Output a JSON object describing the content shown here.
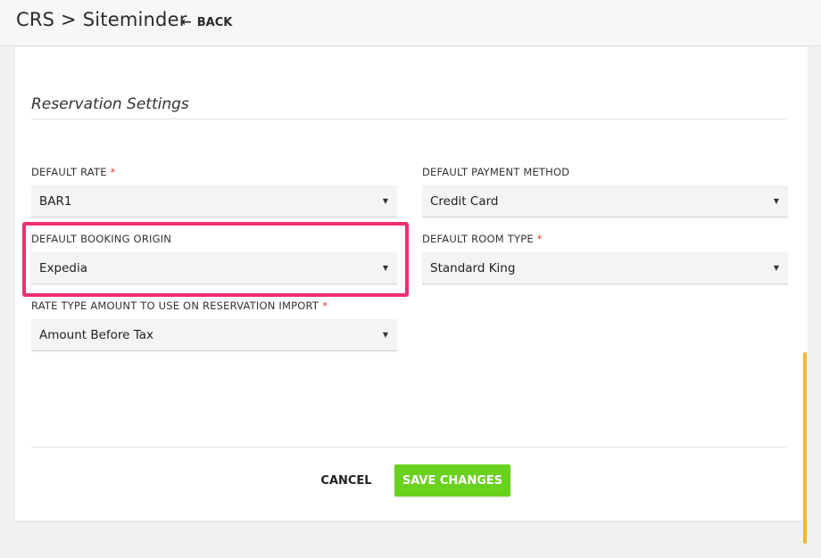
{
  "header": {
    "breadcrumb": "CRS > Siteminder",
    "back_label": "BACK",
    "back_icon": "arrow-left-icon"
  },
  "section": {
    "title": "Reservation Settings"
  },
  "fields": {
    "default_rate": {
      "label": "DEFAULT RATE",
      "required": "*",
      "value": "BAR1"
    },
    "default_payment_method": {
      "label": "DEFAULT PAYMENT METHOD",
      "value": "Credit Card"
    },
    "default_booking_origin": {
      "label": "DEFAULT BOOKING ORIGIN",
      "value": "Expedia"
    },
    "default_room_type": {
      "label": "DEFAULT ROOM TYPE",
      "required": "*",
      "value": "Standard King"
    },
    "rate_type_amount": {
      "label": "RATE TYPE AMOUNT TO USE ON RESERVATION IMPORT",
      "required": "*",
      "value": "Amount Before Tax"
    }
  },
  "actions": {
    "cancel_label": "CANCEL",
    "save_label": "SAVE CHANGES"
  },
  "colors": {
    "save_button": "#6ad11e",
    "highlight": "#f0306e",
    "required_marker": "#e53935",
    "scrollbar": "#f5b731"
  }
}
